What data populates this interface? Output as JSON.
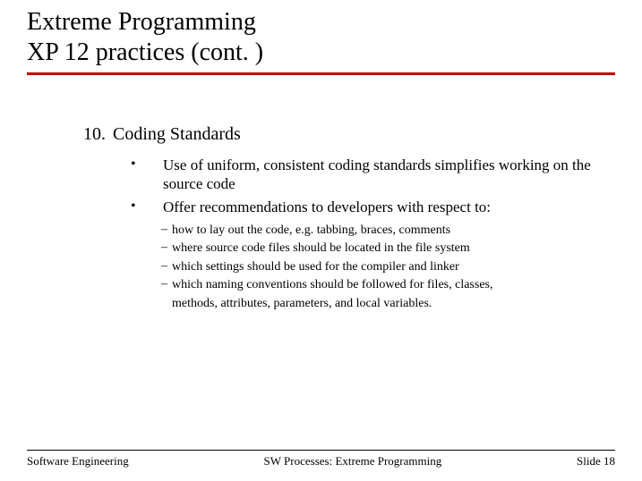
{
  "title": {
    "line1": "Extreme Programming",
    "line2": "XP 12 practices (cont. )"
  },
  "item": {
    "number": "10.",
    "title": "Coding Standards"
  },
  "bullets": [
    "Use of uniform, consistent coding standards simplifies working on the source code",
    "Offer recommendations to developers with respect to:"
  ],
  "subs": [
    "how to lay out the code, e.g. tabbing, braces, comments",
    "where source code files should be located in the file system",
    "which settings should be used for the compiler and linker",
    "which naming conventions should be followed for files, classes,"
  ],
  "subs_cont": "methods, attributes, parameters, and local variables.",
  "footer": {
    "left": "Software Engineering",
    "mid": "SW Processes: Extreme Programming",
    "right": "Slide 18"
  }
}
